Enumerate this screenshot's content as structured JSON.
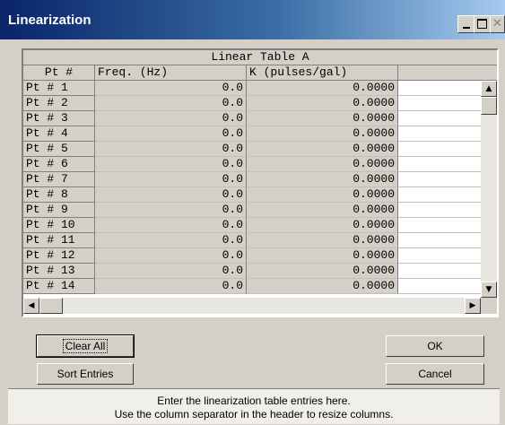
{
  "window": {
    "title": "Linearization"
  },
  "titlebar": {
    "close_glyph": "✕"
  },
  "table": {
    "caption": "Linear Table A",
    "columns": [
      "Pt #",
      "Freq. (Hz)",
      "K (pulses/gal)"
    ],
    "rows": [
      {
        "pt": "Pt # 1",
        "freq": "0.0",
        "k": "0.0000"
      },
      {
        "pt": "Pt # 2",
        "freq": "0.0",
        "k": "0.0000"
      },
      {
        "pt": "Pt # 3",
        "freq": "0.0",
        "k": "0.0000"
      },
      {
        "pt": "Pt # 4",
        "freq": "0.0",
        "k": "0.0000"
      },
      {
        "pt": "Pt # 5",
        "freq": "0.0",
        "k": "0.0000"
      },
      {
        "pt": "Pt # 6",
        "freq": "0.0",
        "k": "0.0000"
      },
      {
        "pt": "Pt # 7",
        "freq": "0.0",
        "k": "0.0000"
      },
      {
        "pt": "Pt # 8",
        "freq": "0.0",
        "k": "0.0000"
      },
      {
        "pt": "Pt # 9",
        "freq": "0.0",
        "k": "0.0000"
      },
      {
        "pt": "Pt # 10",
        "freq": "0.0",
        "k": "0.0000"
      },
      {
        "pt": "Pt # 11",
        "freq": "0.0",
        "k": "0.0000"
      },
      {
        "pt": "Pt # 12",
        "freq": "0.0",
        "k": "0.0000"
      },
      {
        "pt": "Pt # 13",
        "freq": "0.0",
        "k": "0.0000"
      },
      {
        "pt": "Pt # 14",
        "freq": "0.0",
        "k": "0.0000"
      }
    ]
  },
  "scrollbars": {
    "up_glyph": "▲",
    "down_glyph": "▼",
    "left_glyph": "◀",
    "right_glyph": "▶"
  },
  "buttons": {
    "clear_all": "Clear All",
    "sort_entries": "Sort Entries",
    "ok": "OK",
    "cancel": "Cancel"
  },
  "status": {
    "line1": "Enter the linearization table entries here.",
    "line2": "Use the column separator in the header to resize columns."
  },
  "colors": {
    "title_bar_start": "#0a246a",
    "title_bar_end": "#a6caf0",
    "face": "#d4d0c8"
  }
}
